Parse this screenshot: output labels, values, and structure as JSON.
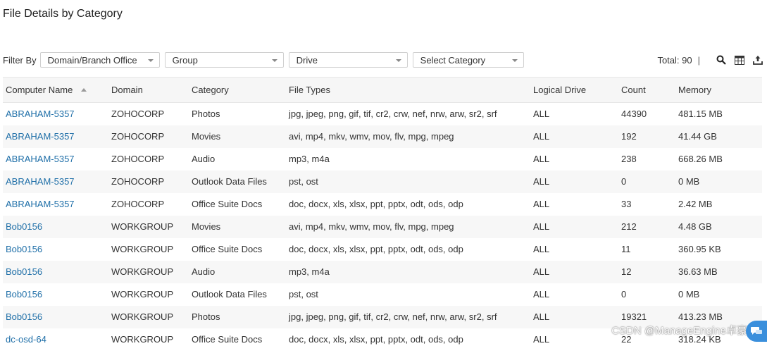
{
  "page": {
    "title": "File Details by Category"
  },
  "filters": {
    "label": "Filter By",
    "domain": "Domain/Branch Office",
    "group": "Group",
    "drive": "Drive",
    "category": "Select Category"
  },
  "toolbar": {
    "total": "Total: 90",
    "separator": "|"
  },
  "table": {
    "columns": [
      "Computer Name",
      "Domain",
      "Category",
      "File Types",
      "Logical Drive",
      "Count",
      "Memory"
    ],
    "sort": {
      "column": "Computer Name",
      "direction": "asc"
    },
    "rows": [
      [
        "ABRAHAM-5357",
        "ZOHOCORP",
        "Photos",
        "jpg, jpeg, png, gif, tif, cr2, crw, nef, nrw, arw, sr2, srf",
        "ALL",
        "44390",
        "481.15 MB"
      ],
      [
        "ABRAHAM-5357",
        "ZOHOCORP",
        "Movies",
        "avi, mp4, mkv, wmv, mov, flv, mpg, mpeg",
        "ALL",
        "192",
        "41.44 GB"
      ],
      [
        "ABRAHAM-5357",
        "ZOHOCORP",
        "Audio",
        "mp3, m4a",
        "ALL",
        "238",
        "668.26 MB"
      ],
      [
        "ABRAHAM-5357",
        "ZOHOCORP",
        "Outlook Data Files",
        "pst, ost",
        "ALL",
        "0",
        "0 MB"
      ],
      [
        "ABRAHAM-5357",
        "ZOHOCORP",
        "Office Suite Docs",
        "doc, docx, xls, xlsx, ppt, pptx, odt, ods, odp",
        "ALL",
        "33",
        "2.42 MB"
      ],
      [
        "Bob0156",
        "WORKGROUP",
        "Movies",
        "avi, mp4, mkv, wmv, mov, flv, mpg, mpeg",
        "ALL",
        "212",
        "4.48 GB"
      ],
      [
        "Bob0156",
        "WORKGROUP",
        "Office Suite Docs",
        "doc, docx, xls, xlsx, ppt, pptx, odt, ods, odp",
        "ALL",
        "11",
        "360.95 KB"
      ],
      [
        "Bob0156",
        "WORKGROUP",
        "Audio",
        "mp3, m4a",
        "ALL",
        "12",
        "36.63 MB"
      ],
      [
        "Bob0156",
        "WORKGROUP",
        "Outlook Data Files",
        "pst, ost",
        "ALL",
        "0",
        "0 MB"
      ],
      [
        "Bob0156",
        "WORKGROUP",
        "Photos",
        "jpg, jpeg, png, gif, tif, cr2, crw, nef, nrw, arw, sr2, srf",
        "ALL",
        "19321",
        "413.23 MB"
      ],
      [
        "dc-osd-64",
        "WORKGROUP",
        "Office Suite Docs",
        "doc, docx, xls, xlsx, ppt, pptx, odt, ods, odp",
        "ALL",
        "22",
        "318.24 KB"
      ]
    ]
  },
  "watermark": "CSDN @ManageEngine卓豪",
  "icons": {
    "search": "search-icon",
    "columns": "table-columns-icon",
    "export": "export-icon",
    "chat": "chat-icon"
  },
  "colors": {
    "link": "#1f6fa8",
    "header_bg": "#f6f6f6",
    "stripe": "#f7f7f7",
    "fab": "#3a8fdc"
  }
}
